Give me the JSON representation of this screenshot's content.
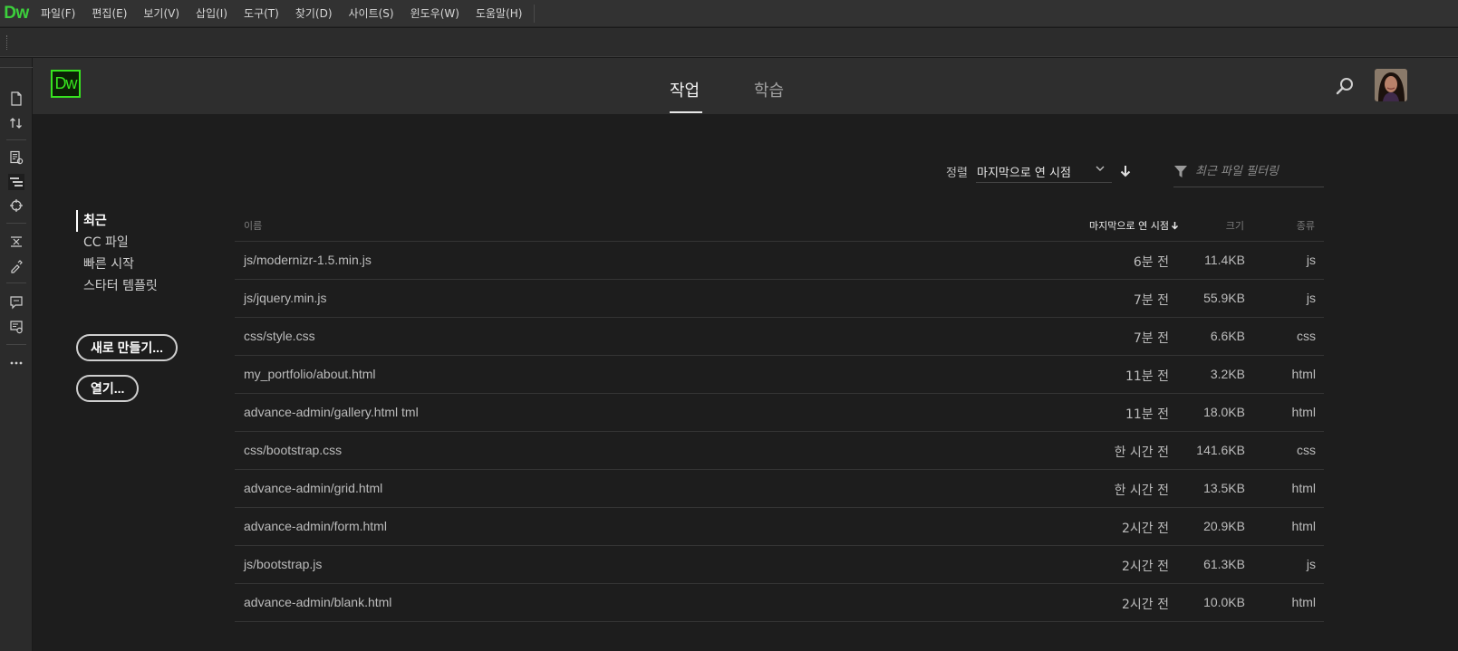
{
  "app": {
    "logo_text": "Dw"
  },
  "menu": {
    "items": [
      "파일(F)",
      "편집(E)",
      "보기(V)",
      "삽입(I)",
      "도구(T)",
      "찾기(D)",
      "사이트(S)",
      "윈도우(W)",
      "도움말(H)"
    ]
  },
  "rail": {
    "icons": [
      "new-file-icon",
      "transfer-icon",
      "properties-icon",
      "dom-icon",
      "insert-icon",
      "css-designer-icon",
      "assets-icon",
      "comment-icon",
      "validate-icon",
      "more-icon"
    ]
  },
  "start_screen": {
    "logo_text": "Dw",
    "tabs": [
      {
        "label": "작업",
        "active": true
      },
      {
        "label": "학습",
        "active": false
      }
    ],
    "nav": {
      "items": [
        {
          "label": "최근",
          "active": true
        },
        {
          "label": "CC 파일",
          "active": false
        },
        {
          "label": "빠른 시작",
          "active": false
        },
        {
          "label": "스타터 템플릿",
          "active": false
        }
      ]
    },
    "buttons": {
      "new_label": "새로 만들기...",
      "open_label": "열기..."
    },
    "sort": {
      "label": "정렬",
      "value": "마지막으로 연 시점",
      "direction": "descending"
    },
    "filter": {
      "placeholder": "최근 파일 필터링",
      "value": ""
    },
    "table": {
      "columns": {
        "name": "이름",
        "date": "마지막으로 연 시점",
        "size": "크기",
        "type": "종류"
      },
      "rows": [
        {
          "name": "js/modernizr-1.5.min.js",
          "date": "6분 전",
          "size": "11.4KB",
          "type": "js"
        },
        {
          "name": "js/jquery.min.js",
          "date": "7분 전",
          "size": "55.9KB",
          "type": "js"
        },
        {
          "name": "css/style.css",
          "date": "7분 전",
          "size": "6.6KB",
          "type": "css"
        },
        {
          "name": "my_portfolio/about.html",
          "date": "11분 전",
          "size": "3.2KB",
          "type": "html"
        },
        {
          "name": "advance-admin/gallery.html tml",
          "date": "11분 전",
          "size": "18.0KB",
          "type": "html"
        },
        {
          "name": "css/bootstrap.css",
          "date": "한 시간 전",
          "size": "141.6KB",
          "type": "css"
        },
        {
          "name": "advance-admin/grid.html",
          "date": "한 시간 전",
          "size": "13.5KB",
          "type": "html"
        },
        {
          "name": "advance-admin/form.html",
          "date": "2시간 전",
          "size": "20.9KB",
          "type": "html"
        },
        {
          "name": "js/bootstrap.js",
          "date": "2시간 전",
          "size": "61.3KB",
          "type": "js"
        },
        {
          "name": "advance-admin/blank.html",
          "date": "2시간 전",
          "size": "10.0KB",
          "type": "html"
        }
      ]
    }
  },
  "colors": {
    "brand": "#37e51f",
    "header_bg": "#2e2e2e",
    "body_bg": "#1d1d1d",
    "menu_bg": "#323232"
  }
}
